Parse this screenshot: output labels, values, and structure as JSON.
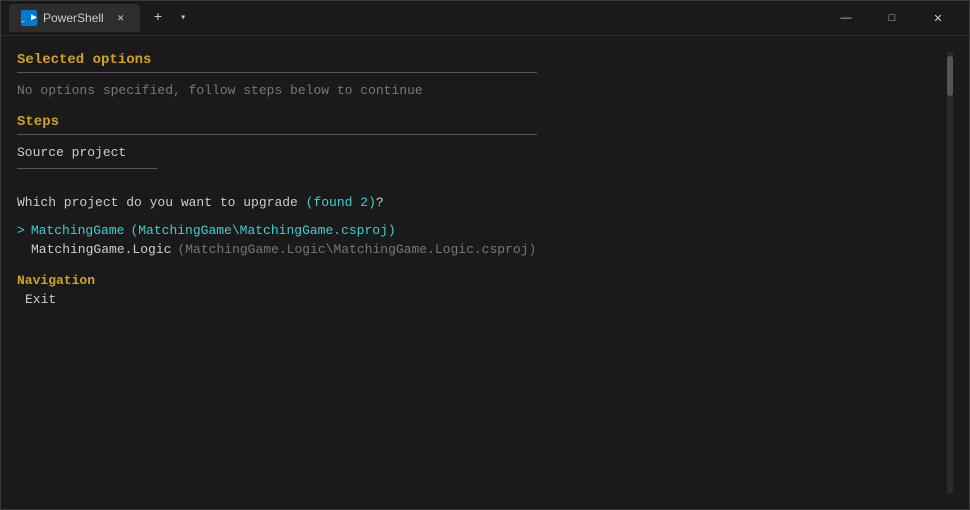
{
  "titlebar": {
    "icon_label": "PS",
    "tab_title": "PowerShell",
    "new_tab_symbol": "+",
    "dropdown_symbol": "▾",
    "minimize_symbol": "—",
    "maximize_symbol": "□",
    "close_symbol": "✕"
  },
  "terminal": {
    "selected_options_heading": "Selected options",
    "no_options_text": "No options specified, follow steps below to continue",
    "steps_heading": "Steps",
    "source_project_label": "Source project",
    "question_text": "Which project do you want to upgrade ",
    "found_count": "(found 2)",
    "question_end": "?",
    "projects": [
      {
        "selected": true,
        "name": "MatchingGame",
        "path": "(MatchingGame\\MatchingGame.csproj)"
      },
      {
        "selected": false,
        "name": "MatchingGame.Logic",
        "path": "(MatchingGame.Logic\\MatchingGame.Logic.csproj)"
      }
    ],
    "navigation_heading": "Navigation",
    "nav_exit": "Exit"
  }
}
